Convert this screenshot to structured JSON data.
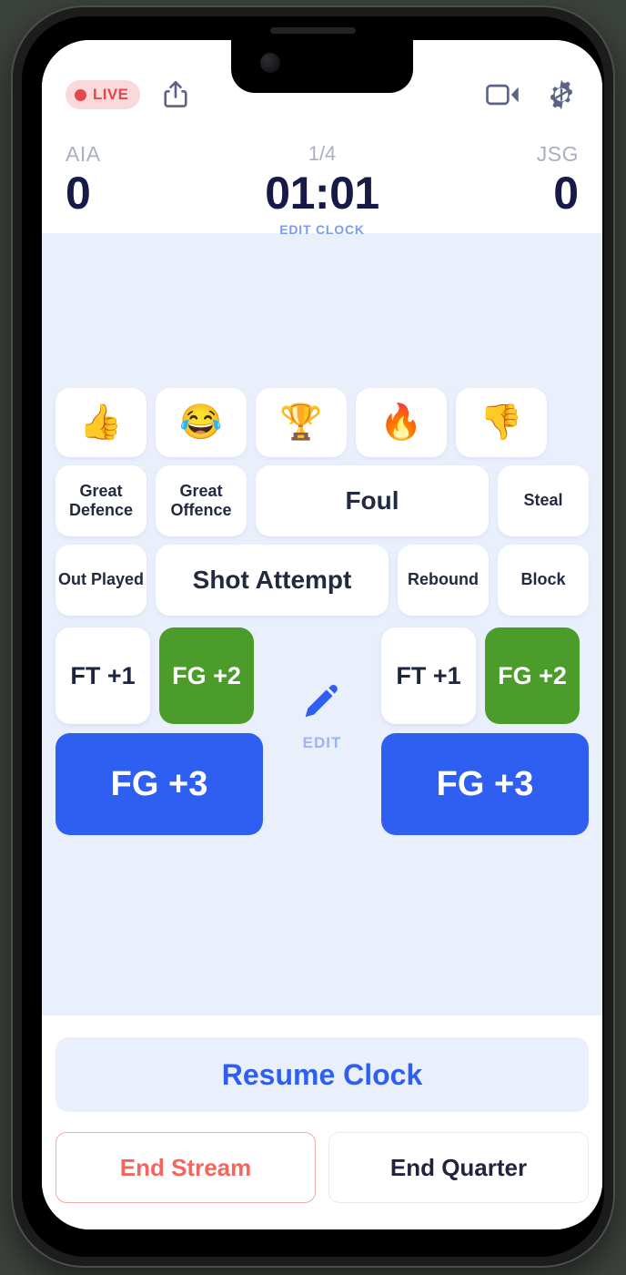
{
  "header": {
    "live_label": "LIVE",
    "icons": {
      "share": "share-icon",
      "video": "video-camera-icon",
      "settings": "gear-icon"
    }
  },
  "scoreboard": {
    "home_team": "AIA",
    "home_score": "0",
    "away_team": "JSG",
    "away_score": "0",
    "period": "1/4",
    "clock": "01:01",
    "edit_clock_label": "EDIT CLOCK"
  },
  "reactions": [
    {
      "name": "thumbs-up",
      "glyph": "👍"
    },
    {
      "name": "joy",
      "glyph": "😂"
    },
    {
      "name": "trophy",
      "glyph": "🏆"
    },
    {
      "name": "fire",
      "glyph": "🔥"
    },
    {
      "name": "thumbs-down",
      "glyph": "👎"
    }
  ],
  "actions_row_1": [
    {
      "name": "great-defence",
      "label": "Great Defence"
    },
    {
      "name": "great-offence",
      "label": "Great Offence"
    },
    {
      "name": "foul",
      "label": "Foul"
    },
    {
      "name": "steal",
      "label": "Steal"
    }
  ],
  "actions_row_2": [
    {
      "name": "out-played",
      "label": "Out Played"
    },
    {
      "name": "shot-attempt",
      "label": "Shot Attempt"
    },
    {
      "name": "rebound",
      "label": "Rebound"
    },
    {
      "name": "block",
      "label": "Block"
    }
  ],
  "scoring": {
    "left": {
      "ft": "FT +1",
      "fg2": "FG +2",
      "fg3": "FG +3"
    },
    "right": {
      "ft": "FT +1",
      "fg2": "FG +2",
      "fg3": "FG +3"
    },
    "edit_label": "EDIT"
  },
  "footer": {
    "resume_clock": "Resume Clock",
    "end_stream": "End Stream",
    "end_quarter": "End Quarter"
  },
  "colors": {
    "accent_blue": "#2f5ff0",
    "green": "#4c9c2c",
    "live_red": "#e0484b",
    "navy": "#151a47",
    "muted": "#a9afc6",
    "content_bg": "#eaeffc"
  }
}
